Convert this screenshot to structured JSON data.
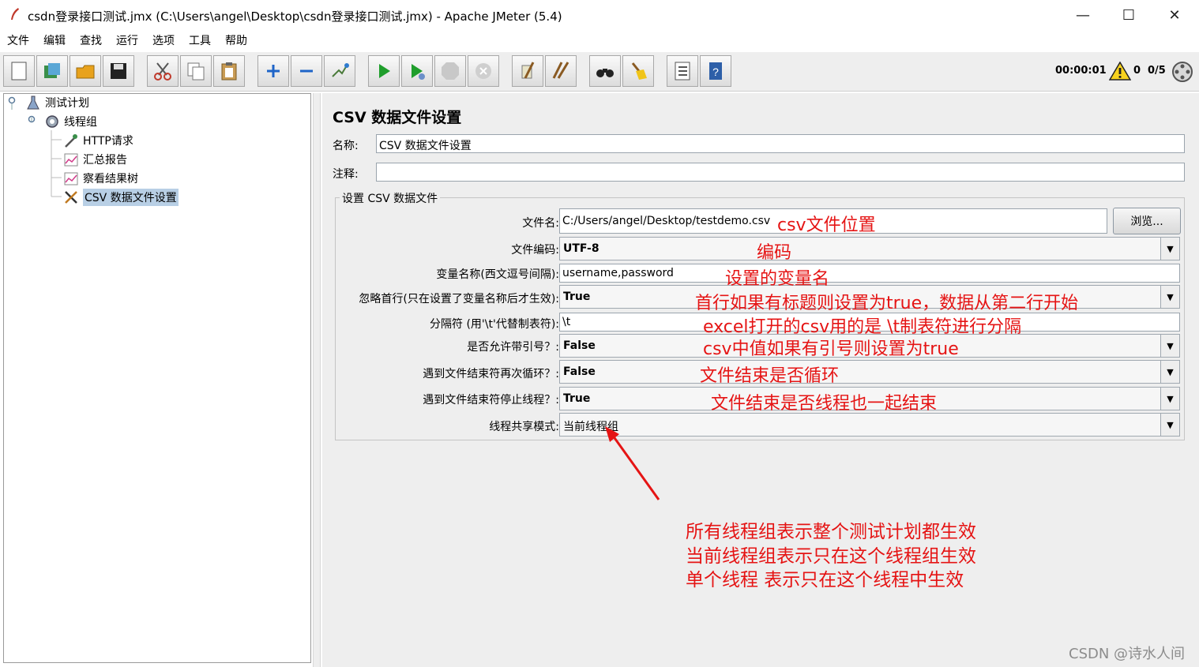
{
  "window": {
    "title": "csdn登录接口测试.jmx (C:\\Users\\angel\\Desktop\\csdn登录接口测试.jmx) - Apache JMeter (5.4)",
    "minimize": "—",
    "maximize": "☐",
    "close": "✕"
  },
  "menu": [
    "文件",
    "编辑",
    "查找",
    "运行",
    "选项",
    "工具",
    "帮助"
  ],
  "toolbar": {
    "icons": [
      "new-icon",
      "templates-icon",
      "open-icon",
      "save-icon",
      "cut-icon",
      "copy-icon",
      "paste-icon",
      "expand-icon",
      "collapse-icon",
      "toggle-icon",
      "start-icon",
      "start-no-pause-icon",
      "stop-icon",
      "shutdown-icon",
      "clear-icon",
      "clear-all-icon",
      "search-icon",
      "reset-search-icon",
      "function-helper-icon",
      "help-icon"
    ],
    "timer": "00:00:01",
    "warning_count": "0",
    "threads": "0/5"
  },
  "tree": {
    "items": [
      {
        "label": "测试计划",
        "icon": "test-plan-icon"
      },
      {
        "label": "线程组",
        "icon": "thread-group-icon"
      },
      {
        "label": "HTTP请求",
        "icon": "pipette-icon"
      },
      {
        "label": "汇总报告",
        "icon": "chart-icon"
      },
      {
        "label": "察看结果树",
        "icon": "chart-icon"
      },
      {
        "label": "CSV 数据文件设置",
        "icon": "tools-icon"
      }
    ]
  },
  "form": {
    "title": "CSV 数据文件设置",
    "name_label": "名称:",
    "name_value": "CSV 数据文件设置",
    "comment_label": "注释:",
    "comment_value": "",
    "group_label": "设置 CSV 数据文件",
    "filename_label": "文件名:",
    "filename_value": "C:/Users/angel/Desktop/testdemo.csv",
    "browse_label": "浏览...",
    "encoding_label": "文件编码:",
    "encoding_value": "UTF-8",
    "varnames_label": "变量名称(西文逗号间隔):",
    "varnames_value": "username,password",
    "ignore_first_label": "忽略首行(只在设置了变量名称后才生效):",
    "ignore_first_value": "True",
    "delimiter_label": "分隔符 (用'\\t'代替制表符):",
    "delimiter_value": "\\t",
    "quoted_label": "是否允许带引号？:",
    "quoted_value": "False",
    "recycle_label": "遇到文件结束符再次循环？:",
    "recycle_value": "False",
    "stop_thread_label": "遇到文件结束符停止线程？:",
    "stop_thread_value": "True",
    "sharing_label": "线程共享模式:",
    "sharing_value": "当前线程组"
  },
  "annotations": {
    "filename": "csv文件位置",
    "encoding": "编码",
    "varnames": "设置的变量名",
    "ignore_first": "首行如果有标题则设置为true，数据从第二行开始",
    "delimiter": "excel打开的csv用的是 \\t制表符进行分隔",
    "quoted": "csv中值如果有引号则设置为true",
    "recycle": "文件结束是否循环",
    "stop_thread": "文件结束是否线程也一起结束",
    "sharing_lines": [
      "所有线程组表示整个测试计划都生效",
      "当前线程组表示只在这个线程组生效",
      "单个线程 表示只在这个线程中生效"
    ],
    "color": "#e51414"
  },
  "watermark": "CSDN @诗水人间"
}
